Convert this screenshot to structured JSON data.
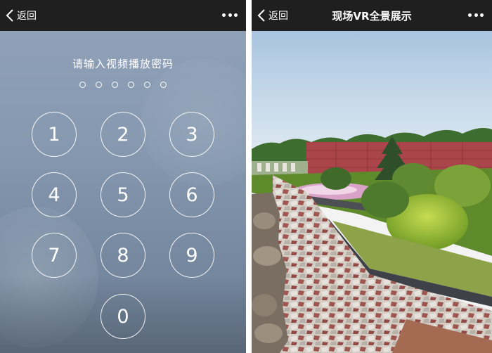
{
  "left_screen": {
    "nav": {
      "back_label": "返回"
    },
    "prompt": "请输入视频播放密码",
    "pin_dots": 6,
    "keys": [
      "1",
      "2",
      "3",
      "4",
      "5",
      "6",
      "7",
      "8",
      "9",
      "0"
    ]
  },
  "right_screen": {
    "nav": {
      "back_label": "返回",
      "title": "现场VR全景展示"
    }
  }
}
